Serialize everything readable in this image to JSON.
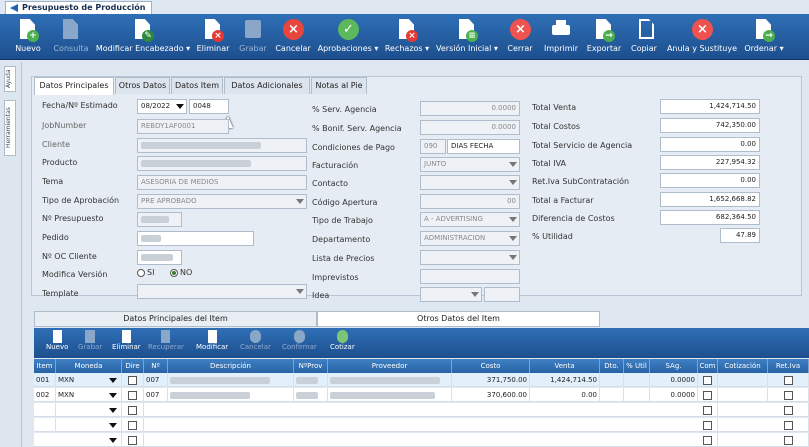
{
  "window": {
    "title": "Presupuesto de Producción"
  },
  "toolbar": {
    "buttons": [
      {
        "label": "Nuevo",
        "icon": "new-doc-icon"
      },
      {
        "label": "Consulta",
        "icon": "consult-icon"
      },
      {
        "label": "Modificar Encabezado",
        "icon": "edit-icon"
      },
      {
        "label": "Eliminar",
        "icon": "delete-doc-icon"
      },
      {
        "label": "Grabar",
        "icon": "save-icon"
      },
      {
        "label": "Cancelar",
        "icon": "cancel-icon"
      },
      {
        "label": "Aprobaciones",
        "icon": "approve-icon"
      },
      {
        "label": "Rechazos",
        "icon": "reject-icon"
      },
      {
        "label": "Versión Inicial",
        "icon": "version-icon"
      },
      {
        "label": "Cerrar",
        "icon": "close-icon"
      },
      {
        "label": "Imprimir",
        "icon": "print-icon"
      },
      {
        "label": "Exportar",
        "icon": "export-icon"
      },
      {
        "label": "Copiar",
        "icon": "copy-icon"
      },
      {
        "label": "Anula y Sustituye",
        "icon": "void-replace-icon"
      },
      {
        "label": "Ordenar",
        "icon": "order-icon"
      }
    ]
  },
  "side_tabs": {
    "help": "Ayuda",
    "tools": "Herramientas"
  },
  "tabs": [
    "Datos Principales",
    "Otros Datos",
    "Datos Item",
    "Datos Adicionales",
    "Notas al Pie"
  ],
  "form": {
    "fecha_label": "Fecha/Nº Estimado",
    "fecha_value": "08/2022",
    "numero_value": "0048",
    "job_label": "JobNumber",
    "job_value": "REBDY1AF0001",
    "cliente_label": "Cliente",
    "producto_label": "Producto",
    "tema_label": "Tema",
    "tema_value": "ASESORIA DE MEDIOS",
    "tipo_aprob_label": "Tipo de Aprobación",
    "tipo_aprob_value": "PRE APROBADO",
    "presupuesto_label": "Nº Presupuesto",
    "pedido_label": "Pedido",
    "oc_label": "Nº OC Cliente",
    "modifica_label": "Modifica Versión",
    "si": "SI",
    "no": "NO",
    "template_label": "Template"
  },
  "form2": {
    "serv_agencia_label": "% Serv. Agencia",
    "serv_agencia_value": "0.0000",
    "bonif_label": "% Bonif. Serv. Agencia",
    "bonif_value": "0.0000",
    "cond_pago_label": "Condiciones de Pago",
    "cond_code": "090",
    "cond_value": "DIAS FECHA",
    "facturacion_label": "Facturación",
    "facturacion_value": "JUNTO",
    "contacto_label": "Contacto",
    "codigo_label": "Código Apertura",
    "codigo_value": "00",
    "tipo_trabajo_label": "Tipo de Trabajo",
    "tipo_trabajo_value": "A - ADVERTISING",
    "depto_label": "Departamento",
    "depto_value": "ADMINISTRACION",
    "lista_label": "Lista de Precios",
    "imprevistos_label": "Imprevistos",
    "idea_label": "Idea"
  },
  "totals": [
    {
      "label": "Total Venta",
      "value": "1,424,714.50"
    },
    {
      "label": "Total Costos",
      "value": "742,350.00"
    },
    {
      "label": "Total Servicio de Agencia",
      "value": "0.00"
    },
    {
      "label": "Total IVA",
      "value": "227,954.32"
    },
    {
      "label": "Ret.Iva SubContratación",
      "value": "0.00"
    },
    {
      "label": "Total a Facturar",
      "value": "1,652,668.82"
    },
    {
      "label": "Diferencia de Costos",
      "value": "682,364.50"
    },
    {
      "label": "% Utilidad",
      "value": "47.89"
    }
  ],
  "bottom_tabs": [
    "Datos Principales del Item",
    "Otros Datos del Item"
  ],
  "grid_toolbar": [
    "Nuevo",
    "Grabar",
    "Eliminar",
    "Recuperar",
    "Modificar",
    "Cancelar",
    "Confirmar",
    "Cotizar"
  ],
  "grid_headers": [
    "Item",
    "Moneda",
    "Dire",
    "Nº",
    "Descripción",
    "NºProv",
    "Proveedor",
    "Costo",
    "Venta",
    "Dto.",
    "% Util",
    "SAg.",
    "Com",
    "Cotización",
    "Ret.Iva"
  ],
  "grid_rows": [
    {
      "item": "001",
      "moneda": "MXN",
      "n": "007",
      "costo": "371,750.00",
      "venta": "1,424,714.50",
      "sag": "0.0000"
    },
    {
      "item": "002",
      "moneda": "MXN",
      "n": "007",
      "costo": "370,600.00",
      "venta": "0.00",
      "sag": "0.0000"
    }
  ]
}
